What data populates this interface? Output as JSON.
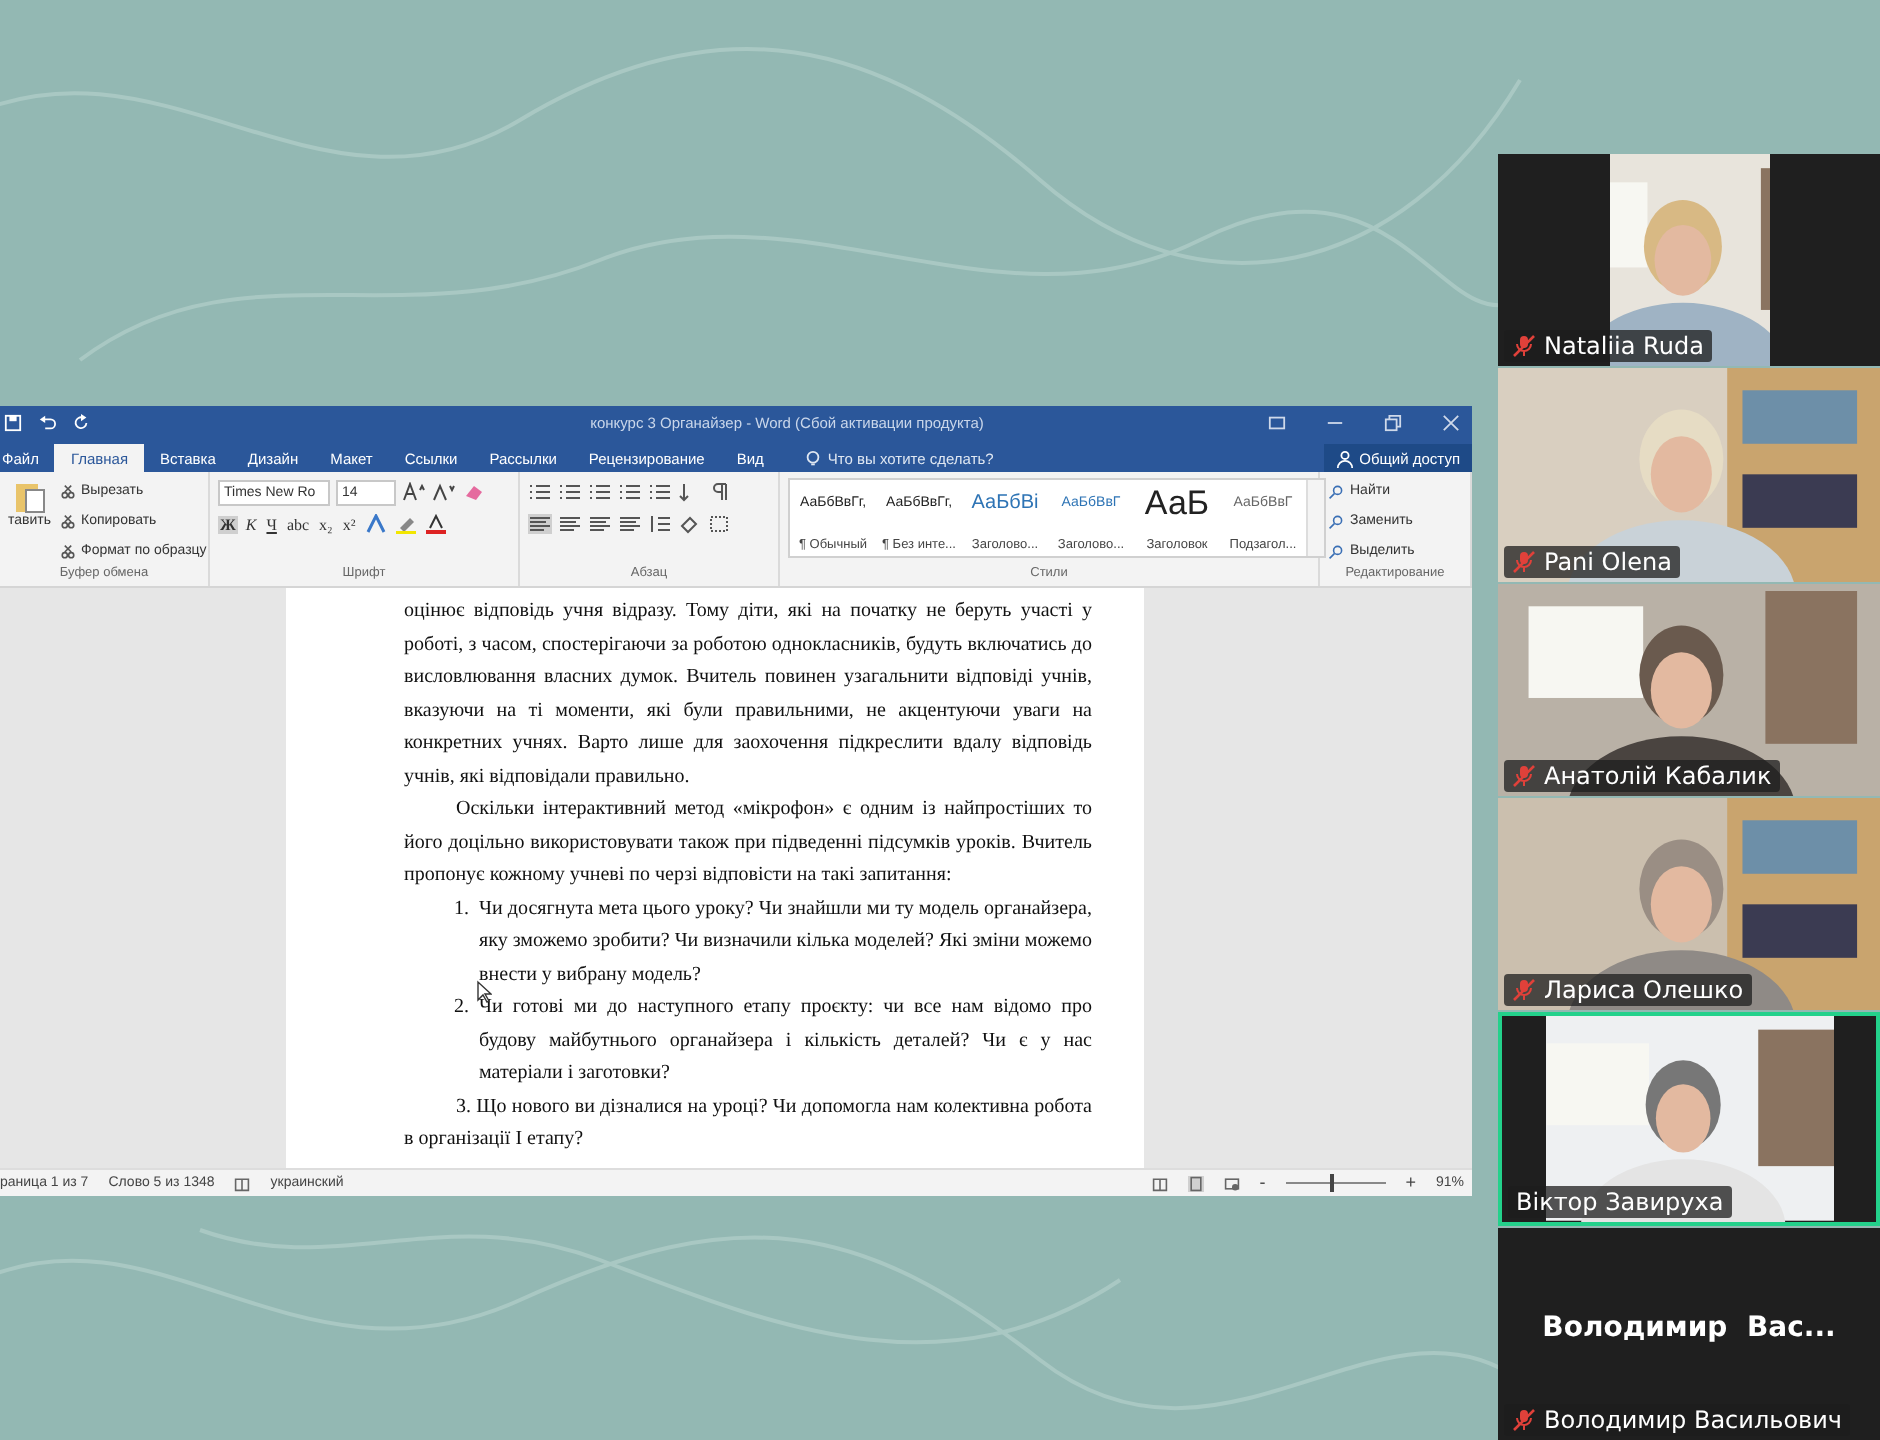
{
  "window": {
    "title": "конкурс 3 Органайзер - Word (Сбой активации продукта)"
  },
  "menu_tabs": [
    {
      "label": "Файл",
      "selected": false
    },
    {
      "label": "Главная",
      "selected": true
    },
    {
      "label": "Вставка",
      "selected": false
    },
    {
      "label": "Дизайн",
      "selected": false
    },
    {
      "label": "Макет",
      "selected": false
    },
    {
      "label": "Ссылки",
      "selected": false
    },
    {
      "label": "Рассылки",
      "selected": false
    },
    {
      "label": "Рецензирование",
      "selected": false
    },
    {
      "label": "Вид",
      "selected": false
    }
  ],
  "tell_me": {
    "placeholder": "Что вы хотите сделать?"
  },
  "share_button": "Общий доступ",
  "ribbon": {
    "clipboard": {
      "paste": "тавить",
      "commands": [
        "Вырезать",
        "Копировать",
        "Формат по образцу"
      ],
      "label": "Буфер обмена"
    },
    "font": {
      "font_name": "Times New Ro",
      "font_size": "14",
      "format_buttons": [
        "Ж",
        "К",
        "Ч",
        "abc",
        "x₂",
        "x²"
      ],
      "label": "Шрифт"
    },
    "paragraph": {
      "label": "Абзац"
    },
    "styles": {
      "items": [
        {
          "sample": "АаБбВвГг,",
          "name": "¶ Обычный",
          "kind": "normal"
        },
        {
          "sample": "АаБбВвГг,",
          "name": "¶ Без инте...",
          "kind": "normal"
        },
        {
          "sample": "АаБбВі",
          "name": "Заголово...",
          "kind": "heading1"
        },
        {
          "sample": "АаБбВвГ",
          "name": "Заголово...",
          "kind": "heading2"
        },
        {
          "sample": "АаБ",
          "name": "Заголовок",
          "kind": "title"
        },
        {
          "sample": "АаБбВвГ",
          "name": "Подзагол...",
          "kind": "subtitle"
        }
      ],
      "label": "Стили"
    },
    "editing": {
      "commands": [
        "Найти",
        "Заменить",
        "Выделить"
      ],
      "label": "Редактирование"
    }
  },
  "document": {
    "blocks": [
      {
        "kind": "paragraph",
        "indent": false,
        "text": "оцінює відповідь учня відразу. Тому діти, які на початку не беруть участі у роботі, з часом, спостерігаючи за роботою однокласників, будуть включатись до висловлювання власних думок. Вчитель повинен узагальнити відповіді учнів, вказуючи на ті моменти, які були правильними, не акцентуючи уваги на конкретних учнях. Варто лише для заохочення підкреслити вдалу відповідь учнів, які відповідали правильно."
      },
      {
        "kind": "paragraph",
        "indent": true,
        "text": "Оскільки інтерактивний метод «мікрофон» є одним із найпростіших то його доцільно використовувати також при підведенні підсумків уроків. Вчитель пропонує кожному учневі по черзі відповісти на такі запитання:"
      },
      {
        "kind": "list_item",
        "number": "1.",
        "text": "Чи досягнута мета цього уроку? Чи знайшли ми ту модель органайзера, яку зможемо зробити? Чи визначили кілька моделей? Які зміни можемо внести у вибрану модель?"
      },
      {
        "kind": "list_item",
        "number": "2.",
        "text": "Чи готові ми до наступного етапу проєкту: чи все нам відомо про будову майбутнього органайзера і кількість деталей? Чи є у нас матеріали і заготовки?"
      },
      {
        "kind": "paragraph",
        "indent": true,
        "text": "3. Що нового ви дізналися на уроці? Чи допомогла нам колективна робота в організації І етапу?"
      }
    ]
  },
  "status_bar": {
    "page": "раница 1 из 7",
    "words": "Слово 5 из 1348",
    "language": "украинский",
    "zoom": "91%",
    "zoom_out": "-",
    "zoom_in": "+",
    "zoom_slider": {
      "level": 0.45
    }
  },
  "participants": [
    {
      "name": "Nataliia Ruda",
      "muted": true,
      "selected": false,
      "kind": "narrow"
    },
    {
      "name": "Pani Olena",
      "muted": true,
      "selected": false,
      "kind": "full"
    },
    {
      "name": "Анатолій Кабалик",
      "muted": true,
      "selected": false,
      "kind": "full"
    },
    {
      "name": "Лариса Олешко",
      "muted": true,
      "selected": false,
      "kind": "full"
    },
    {
      "name": "Віктор Завируха",
      "muted": false,
      "selected": true,
      "kind": "medium"
    },
    {
      "name": "Володимир Васильович",
      "display_name": "Володимир  Вас...",
      "muted": true,
      "selected": false,
      "kind": "none"
    }
  ]
}
